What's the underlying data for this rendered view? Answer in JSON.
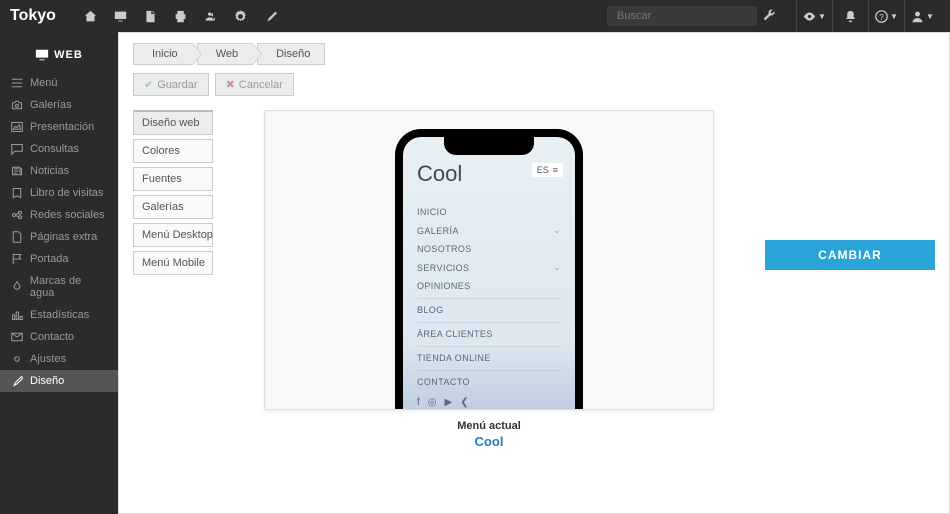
{
  "brand": "Tokyo",
  "search": {
    "placeholder": "Buscar"
  },
  "sidebar": {
    "header": "WEB",
    "items": [
      {
        "label": "Menú",
        "icon": "menu-icon"
      },
      {
        "label": "Galerías",
        "icon": "camera-icon"
      },
      {
        "label": "Presentación",
        "icon": "image-icon"
      },
      {
        "label": "Consultas",
        "icon": "comment-icon"
      },
      {
        "label": "Noticias",
        "icon": "news-icon"
      },
      {
        "label": "Libro de visitas",
        "icon": "book-icon"
      },
      {
        "label": "Redes sociales",
        "icon": "share-icon"
      },
      {
        "label": "Páginas extra",
        "icon": "page-icon"
      },
      {
        "label": "Portada",
        "icon": "flag-icon"
      },
      {
        "label": "Marcas de agua",
        "icon": "droplet-icon"
      },
      {
        "label": "Estadísticas",
        "icon": "stats-icon"
      },
      {
        "label": "Contacto",
        "icon": "envelope-icon"
      },
      {
        "label": "Ajustes",
        "icon": "gear-icon"
      },
      {
        "label": "Diseño",
        "icon": "brush-icon"
      }
    ],
    "active_index": 13
  },
  "breadcrumb": [
    "Inicio",
    "Web",
    "Diseño"
  ],
  "actions": {
    "save": "Guardar",
    "cancel": "Cancelar"
  },
  "design_tabs": [
    "Diseño web",
    "Colores",
    "Fuentes",
    "Galerías",
    "Menú Desktop",
    "Menú Mobile"
  ],
  "design_tabs_active": 0,
  "phone": {
    "title": "Cool",
    "lang": "ES",
    "menu": [
      "INICIO",
      "GALERÍA",
      "NOSOTROS",
      "SERVICIOS",
      "OPINIONES",
      "BLOG",
      "ÁREA CLIENTES",
      "TIENDA ONLINE",
      "CONTACTO"
    ],
    "expandable": [
      1,
      3
    ]
  },
  "caption": {
    "label": "Menú actual",
    "value": "Cool"
  },
  "change_btn": "CAMBIAR"
}
